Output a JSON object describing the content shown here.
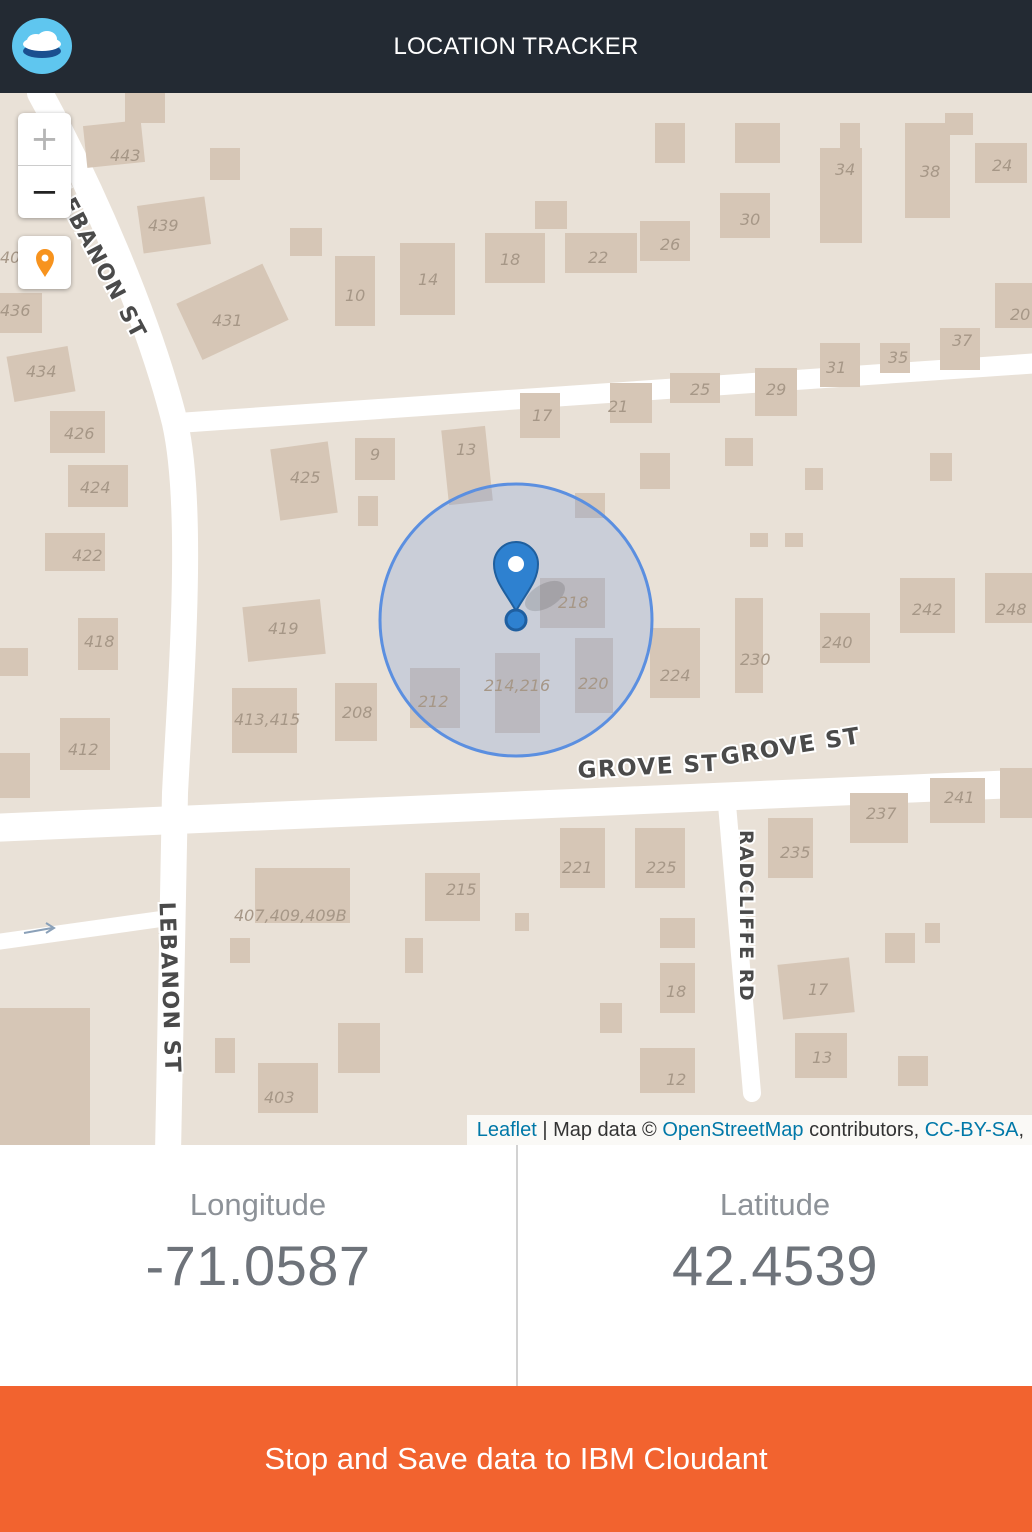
{
  "header": {
    "title": "LOCATION TRACKER",
    "logo_icon": "cloudant-logo-icon"
  },
  "map": {
    "zoom_in_label": "+",
    "zoom_out_label": "−",
    "locate_icon": "location-pin-icon",
    "marker_icon": "map-marker-icon",
    "accuracy_circle_color": "#5b8fe0",
    "street_labels": {
      "grove_st_1": "GROVE ST",
      "grove_st_2": "GROVE ST",
      "lebanon_st_top": "LEBANON ST",
      "lebanon_st_bottom": "LEBANON ST",
      "radcliffe_rd": "RADCLIFFE RD"
    },
    "house_numbers": [
      "443",
      "439",
      "431",
      "436",
      "434",
      "426",
      "424",
      "422",
      "418",
      "412",
      "425",
      "419",
      "413,415",
      "208",
      "212",
      "214,216",
      "220",
      "218",
      "224",
      "230",
      "240",
      "242",
      "248",
      "10",
      "14",
      "18",
      "22",
      "26",
      "30",
      "34",
      "38",
      "24",
      "9",
      "13",
      "17",
      "21",
      "25",
      "29",
      "31",
      "35",
      "37",
      "20",
      "407,409,409B",
      "215",
      "221",
      "225",
      "235",
      "237",
      "241",
      "17",
      "13",
      "12",
      "18",
      "403",
      "40"
    ],
    "attribution": {
      "leaflet": "Leaflet",
      "separator": " | Map data © ",
      "osm": "OpenStreetMap",
      "contributors": " contributors, ",
      "license": "CC-BY-SA",
      "trailing": ","
    }
  },
  "coordinates": {
    "longitude_label": "Longitude",
    "longitude_value": "-71.0587",
    "latitude_label": "Latitude",
    "latitude_value": "42.4539"
  },
  "actions": {
    "save_label": "Stop and Save data to IBM Cloudant"
  },
  "colors": {
    "header_bg": "#232a33",
    "button_bg": "#f2632f",
    "link": "#0078a8"
  }
}
